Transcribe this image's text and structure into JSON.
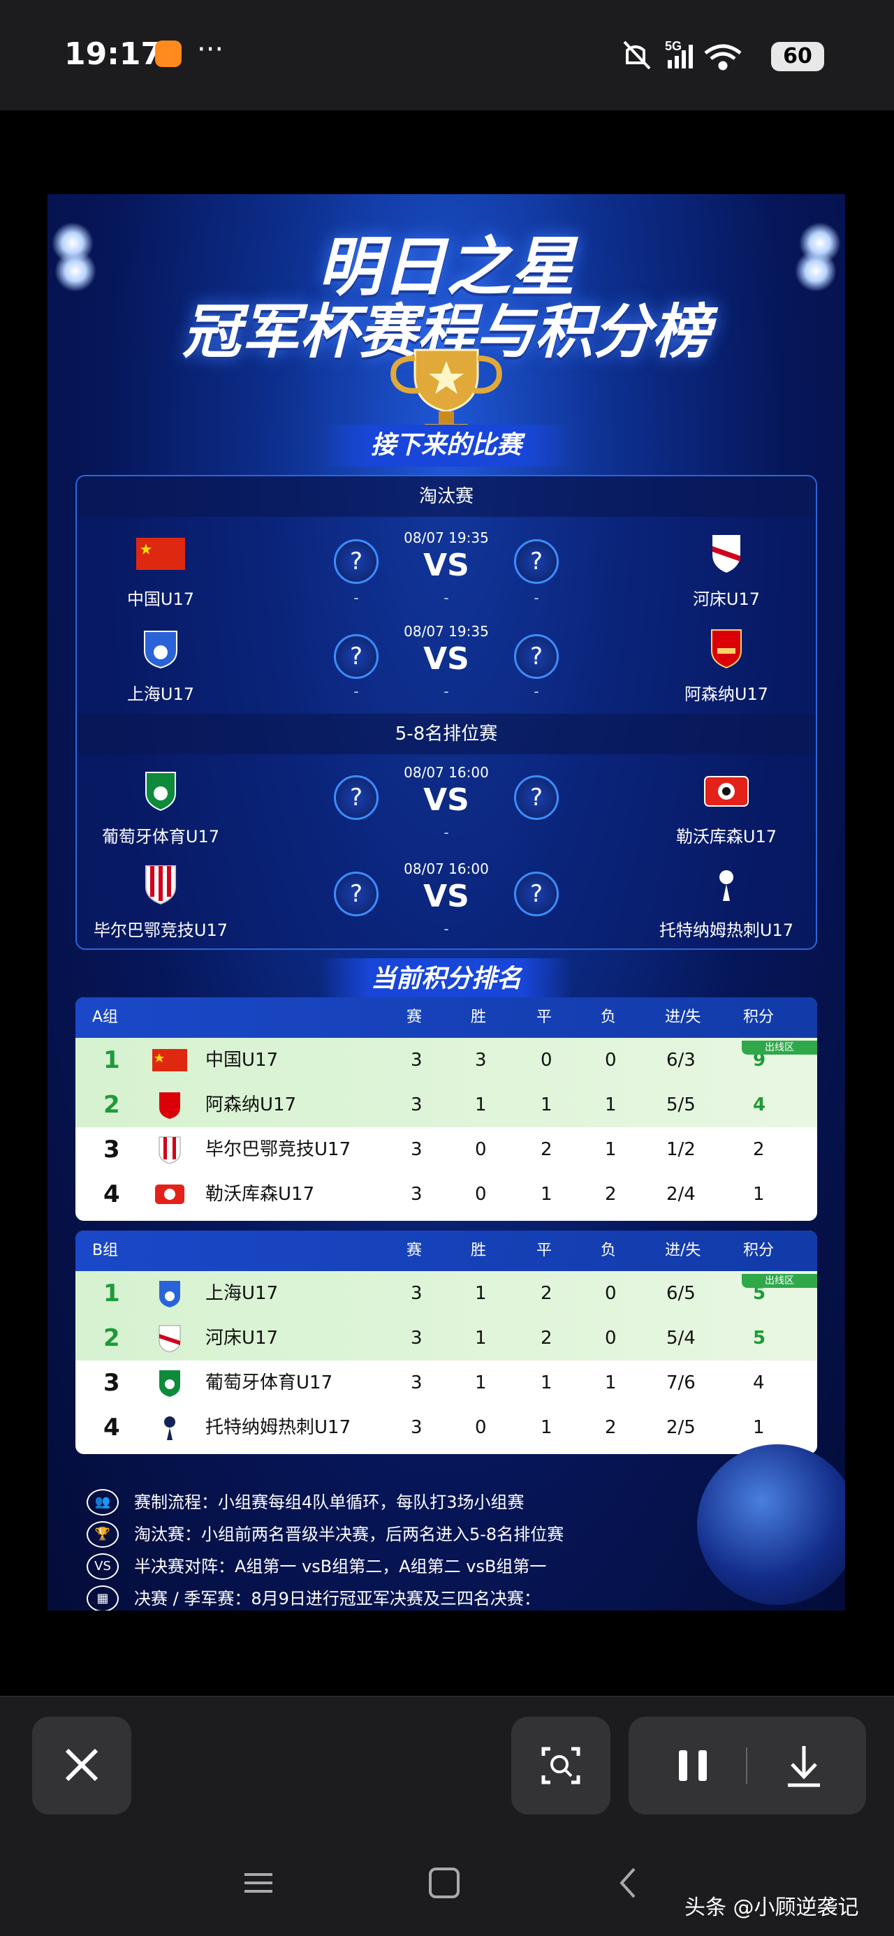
{
  "status_bar": {
    "time": "19:17",
    "dots": "···",
    "network": "5G",
    "battery": "60"
  },
  "poster": {
    "title_line1": "明日之星",
    "title_line2": "冠军杯赛程与积分榜",
    "upcoming_banner": "接下来的比赛",
    "standings_banner": "当前积分排名",
    "sections": [
      {
        "label": "淘汰赛",
        "matches": [
          {
            "home": "中国U17",
            "away": "河床U17",
            "time": "08/07 19:35",
            "vs": "VS",
            "score_home": "-",
            "score_away": "-",
            "mid": "-"
          },
          {
            "home": "上海U17",
            "away": "阿森纳U17",
            "time": "08/07 19:35",
            "vs": "VS",
            "score_home": "-",
            "score_away": "-",
            "mid": "-"
          }
        ]
      },
      {
        "label": "5-8名排位赛",
        "matches": [
          {
            "home": "葡萄牙体育U17",
            "away": "勒沃库森U17",
            "time": "08/07 16:00",
            "vs": "VS",
            "mid": "-"
          },
          {
            "home": "毕尔巴鄂竞技U17",
            "away": "托特纳姆热刺U17",
            "time": "08/07 16:00",
            "vs": "VS",
            "mid": "-"
          }
        ]
      }
    ],
    "qm": "?",
    "columns": [
      "赛",
      "胜",
      "平",
      "负",
      "进/失",
      "积分"
    ],
    "qualify_tag": "出线区",
    "groups": [
      {
        "name": "A组",
        "rows": [
          {
            "rank": "1",
            "team": "中国U17",
            "p": "3",
            "w": "3",
            "d": "0",
            "l": "0",
            "gd": "6/3",
            "pts": "9",
            "qualified": true
          },
          {
            "rank": "2",
            "team": "阿森纳U17",
            "p": "3",
            "w": "1",
            "d": "1",
            "l": "1",
            "gd": "5/5",
            "pts": "4",
            "qualified": true
          },
          {
            "rank": "3",
            "team": "毕尔巴鄂竞技U17",
            "p": "3",
            "w": "0",
            "d": "2",
            "l": "1",
            "gd": "1/2",
            "pts": "2",
            "qualified": false
          },
          {
            "rank": "4",
            "team": "勒沃库森U17",
            "p": "3",
            "w": "0",
            "d": "1",
            "l": "2",
            "gd": "2/4",
            "pts": "1",
            "qualified": false
          }
        ]
      },
      {
        "name": "B组",
        "rows": [
          {
            "rank": "1",
            "team": "上海U17",
            "p": "3",
            "w": "1",
            "d": "2",
            "l": "0",
            "gd": "6/5",
            "pts": "5",
            "qualified": true
          },
          {
            "rank": "2",
            "team": "河床U17",
            "p": "3",
            "w": "1",
            "d": "2",
            "l": "0",
            "gd": "5/4",
            "pts": "5",
            "qualified": true
          },
          {
            "rank": "3",
            "team": "葡萄牙体育U17",
            "p": "3",
            "w": "1",
            "d": "1",
            "l": "1",
            "gd": "7/6",
            "pts": "4",
            "qualified": false
          },
          {
            "rank": "4",
            "team": "托特纳姆热刺U17",
            "p": "3",
            "w": "0",
            "d": "1",
            "l": "2",
            "gd": "2/5",
            "pts": "1",
            "qualified": false
          }
        ]
      }
    ],
    "notes": [
      {
        "icon": "people-icon",
        "glyph": "👥",
        "text": "赛制流程：小组赛每组4队单循环，每队打3场小组赛"
      },
      {
        "icon": "trophy-icon",
        "glyph": "🏆",
        "text": "淘汰赛：小组前两名晋级半决赛，后两名进入5-8名排位赛"
      },
      {
        "icon": "vs-icon",
        "glyph": "VS",
        "text": "半决赛对阵：A组第一 vsB组第二，A组第二 vsB组第一"
      },
      {
        "icon": "calendar-icon",
        "glyph": "▦",
        "text": "决赛 / 季军赛：8月9日进行冠亚军决赛及三四名决赛："
      }
    ]
  },
  "watermark": "头条 @小顾逆袭记"
}
